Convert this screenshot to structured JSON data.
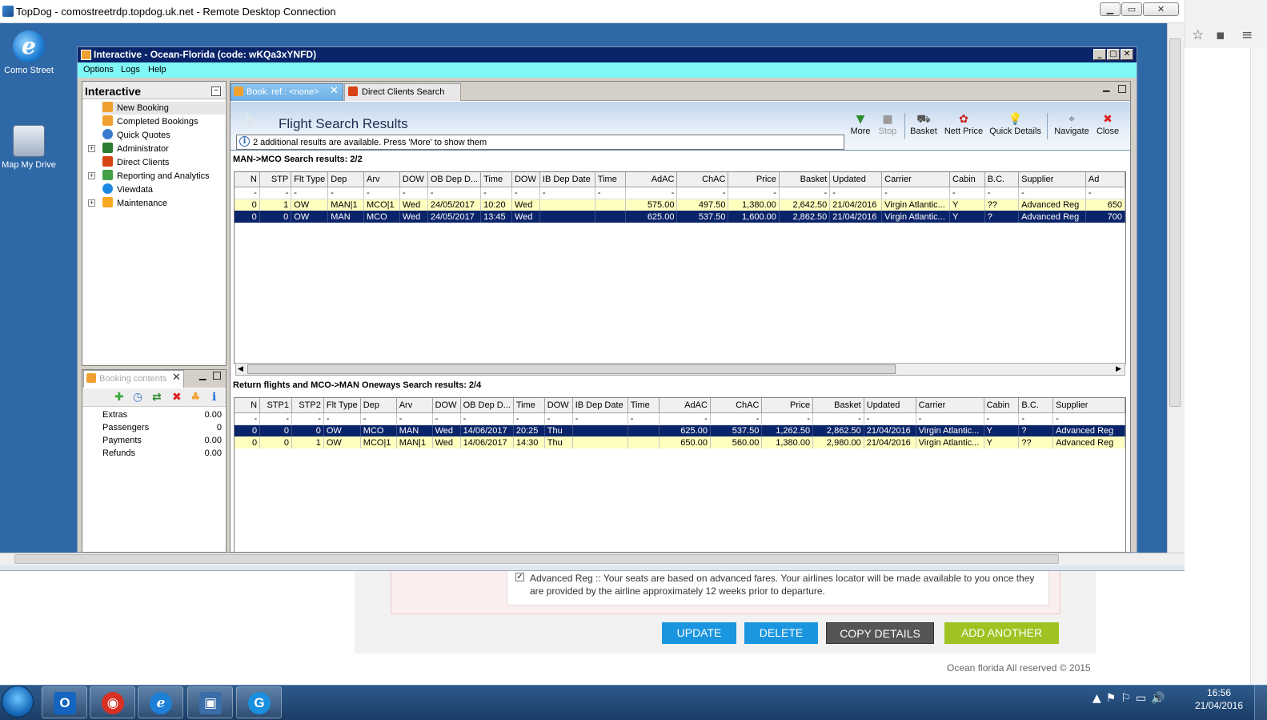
{
  "rdp": {
    "title": "TopDog - comostreetrdp.topdog.uk.net - Remote Desktop Connection",
    "controls": [
      "▁",
      "▭",
      "✕"
    ]
  },
  "desktop": {
    "icons": [
      {
        "label": "Como Street",
        "icon": "internet-explorer-icon"
      },
      {
        "label": "Map My Drive",
        "icon": "network-drive-icon"
      }
    ]
  },
  "app": {
    "title": "Interactive - Ocean-Florida (code: wKQa3xYNFD)",
    "menu": [
      "Options",
      "Logs",
      "Help"
    ]
  },
  "tree": {
    "header": "Interactive",
    "items": [
      {
        "label": "New Booking",
        "icon": "palm-tree-icon",
        "color": "#f0a030"
      },
      {
        "label": "Completed Bookings",
        "icon": "palm-tree-icon",
        "color": "#f0a030"
      },
      {
        "label": "Quick Quotes",
        "icon": "clock-icon",
        "color": "#3a7ad0"
      },
      {
        "label": "Administrator",
        "icon": "user-icon",
        "color": "#2e7d32"
      },
      {
        "label": "Direct Clients",
        "icon": "people-icon",
        "color": "#d84315"
      },
      {
        "label": "Reporting and Analytics",
        "icon": "report-icon",
        "color": "#43a047"
      },
      {
        "label": "Viewdata",
        "icon": "globe-icon",
        "color": "#1e88e5"
      },
      {
        "label": "Maintenance",
        "icon": "box-icon",
        "color": "#f9a825"
      }
    ]
  },
  "booking_contents": {
    "tab_label": "Booking contents",
    "rows": [
      {
        "label": "Extras",
        "value": "0.00"
      },
      {
        "label": "Passengers",
        "value": "0"
      },
      {
        "label": "Payments",
        "value": "0.00"
      },
      {
        "label": "Refunds",
        "value": "0.00"
      }
    ]
  },
  "tabs": [
    {
      "label": "Book. ref.: <none>",
      "active": true
    },
    {
      "label": "Direct Clients Search",
      "active": false
    }
  ],
  "results": {
    "title": "Flight Search Results",
    "info": "2 additional results are available. Press 'More' to show them",
    "toolbar": [
      {
        "label": "More",
        "icon": "down-arrow-icon",
        "color": "#2e8b2e",
        "enabled": true
      },
      {
        "label": "Stop",
        "icon": "stop-icon",
        "color": "#999999",
        "enabled": false
      },
      {
        "label": "Basket",
        "icon": "basket-icon",
        "color": "#555555",
        "enabled": true
      },
      {
        "label": "Nett Price",
        "icon": "price-icon",
        "color": "#cc2222",
        "enabled": true
      },
      {
        "label": "Quick Details",
        "icon": "lightbulb-icon",
        "color": "#e8b800",
        "enabled": true
      },
      {
        "label": "Navigate",
        "icon": "navigate-icon",
        "color": "#556677",
        "enabled": true
      },
      {
        "label": "Close",
        "icon": "close-icon",
        "color": "#dd2222",
        "enabled": true
      }
    ]
  },
  "outbound": {
    "title": "MAN->MCO Search results: 2/2",
    "columns": [
      "N",
      "STP",
      "Flt Type",
      "Dep",
      "Arv",
      "DOW",
      "OB Dep D...",
      "Time",
      "DOW",
      "IB Dep Date",
      "Time",
      "AdAC",
      "ChAC",
      "Price",
      "Basket",
      "Updated",
      "Carrier",
      "Cabin",
      "B.C.",
      "Supplier",
      "Ad"
    ],
    "filter": [
      "-",
      "-",
      "-",
      "-",
      "-",
      "-",
      "-",
      "-",
      "-",
      "-",
      "-",
      "-",
      "-",
      "-",
      "-",
      "-",
      "-",
      "-",
      "-",
      "-",
      "-"
    ],
    "rows": [
      {
        "style": "yellow",
        "cells": [
          "0",
          "1",
          "OW",
          "MAN|1",
          "MCO|1",
          "Wed",
          "24/05/2017",
          "10:20",
          "Wed",
          "",
          "",
          "575.00",
          "497.50",
          "1,380.00",
          "2,642.50",
          "21/04/2016",
          "Virgin Atlantic...",
          "Y",
          "??",
          "Advanced Reg",
          "650"
        ]
      },
      {
        "style": "sel",
        "cells": [
          "0",
          "0",
          "OW",
          "MAN",
          "MCO",
          "Wed",
          "24/05/2017",
          "13:45",
          "Wed",
          "",
          "",
          "625.00",
          "537.50",
          "1,600.00",
          "2,862.50",
          "21/04/2016",
          "Virgin Atlantic...",
          "Y",
          "?",
          "Advanced Reg",
          "700"
        ]
      }
    ]
  },
  "return": {
    "title": "Return flights and MCO->MAN Oneways Search results: 2/4",
    "columns": [
      "N",
      "STP1",
      "STP2",
      "Flt Type",
      "Dep",
      "Arv",
      "DOW",
      "OB Dep D...",
      "Time",
      "DOW",
      "IB Dep Date",
      "Time",
      "AdAC",
      "ChAC",
      "Price",
      "Basket",
      "Updated",
      "Carrier",
      "Cabin",
      "B.C.",
      "Supplier"
    ],
    "filter": [
      "-",
      "-",
      "-",
      "-",
      "-",
      "-",
      "-",
      "-",
      "-",
      "-",
      "-",
      "-",
      "-",
      "-",
      "-",
      "-",
      "-",
      "-",
      "-",
      "-",
      "-"
    ],
    "rows": [
      {
        "style": "sel",
        "cells": [
          "0",
          "0",
          "0",
          "OW",
          "MCO",
          "MAN",
          "Wed",
          "14/06/2017",
          "20:25",
          "Thu",
          "",
          "",
          "625.00",
          "537.50",
          "1,262.50",
          "2,862.50",
          "21/04/2016",
          "Virgin Atlantic...",
          "Y",
          "?",
          "Advanced Reg"
        ]
      },
      {
        "style": "yellow",
        "cells": [
          "0",
          "0",
          "1",
          "OW",
          "MCO|1",
          "MAN|1",
          "Wed",
          "14/06/2017",
          "14:30",
          "Thu",
          "",
          "",
          "650.00",
          "560.00",
          "1,380.00",
          "2,980.00",
          "21/04/2016",
          "Virgin Atlantic...",
          "Y",
          "??",
          "Advanced Reg"
        ]
      }
    ]
  },
  "web": {
    "notice": "Advanced Reg :: Your seats are based on advanced fares. Your airlines locator will be made available to you once they are provided by the airline approximately 12 weeks prior to departure.",
    "buttons": {
      "update": "UPDATE",
      "delete": "DELETE",
      "copy": "COPY DETAILS",
      "add": "ADD ANOTHER"
    },
    "footer": "Ocean florida All reserved © 2015"
  },
  "taskbar": {
    "time": "16:56",
    "date": "21/04/2016",
    "apps": [
      {
        "icon": "outlook-icon",
        "glyph": "O",
        "color": "#1565c0"
      },
      {
        "icon": "chrome-icon",
        "glyph": "◉",
        "color": "#d93025"
      },
      {
        "icon": "internet-explorer-icon",
        "glyph": "e",
        "color": "#1e7fd6"
      },
      {
        "icon": "remote-desktop-icon",
        "glyph": "▣",
        "color": "#3b6ea8"
      },
      {
        "icon": "g-app-icon",
        "glyph": "G",
        "color": "#1a8fe0"
      }
    ]
  }
}
